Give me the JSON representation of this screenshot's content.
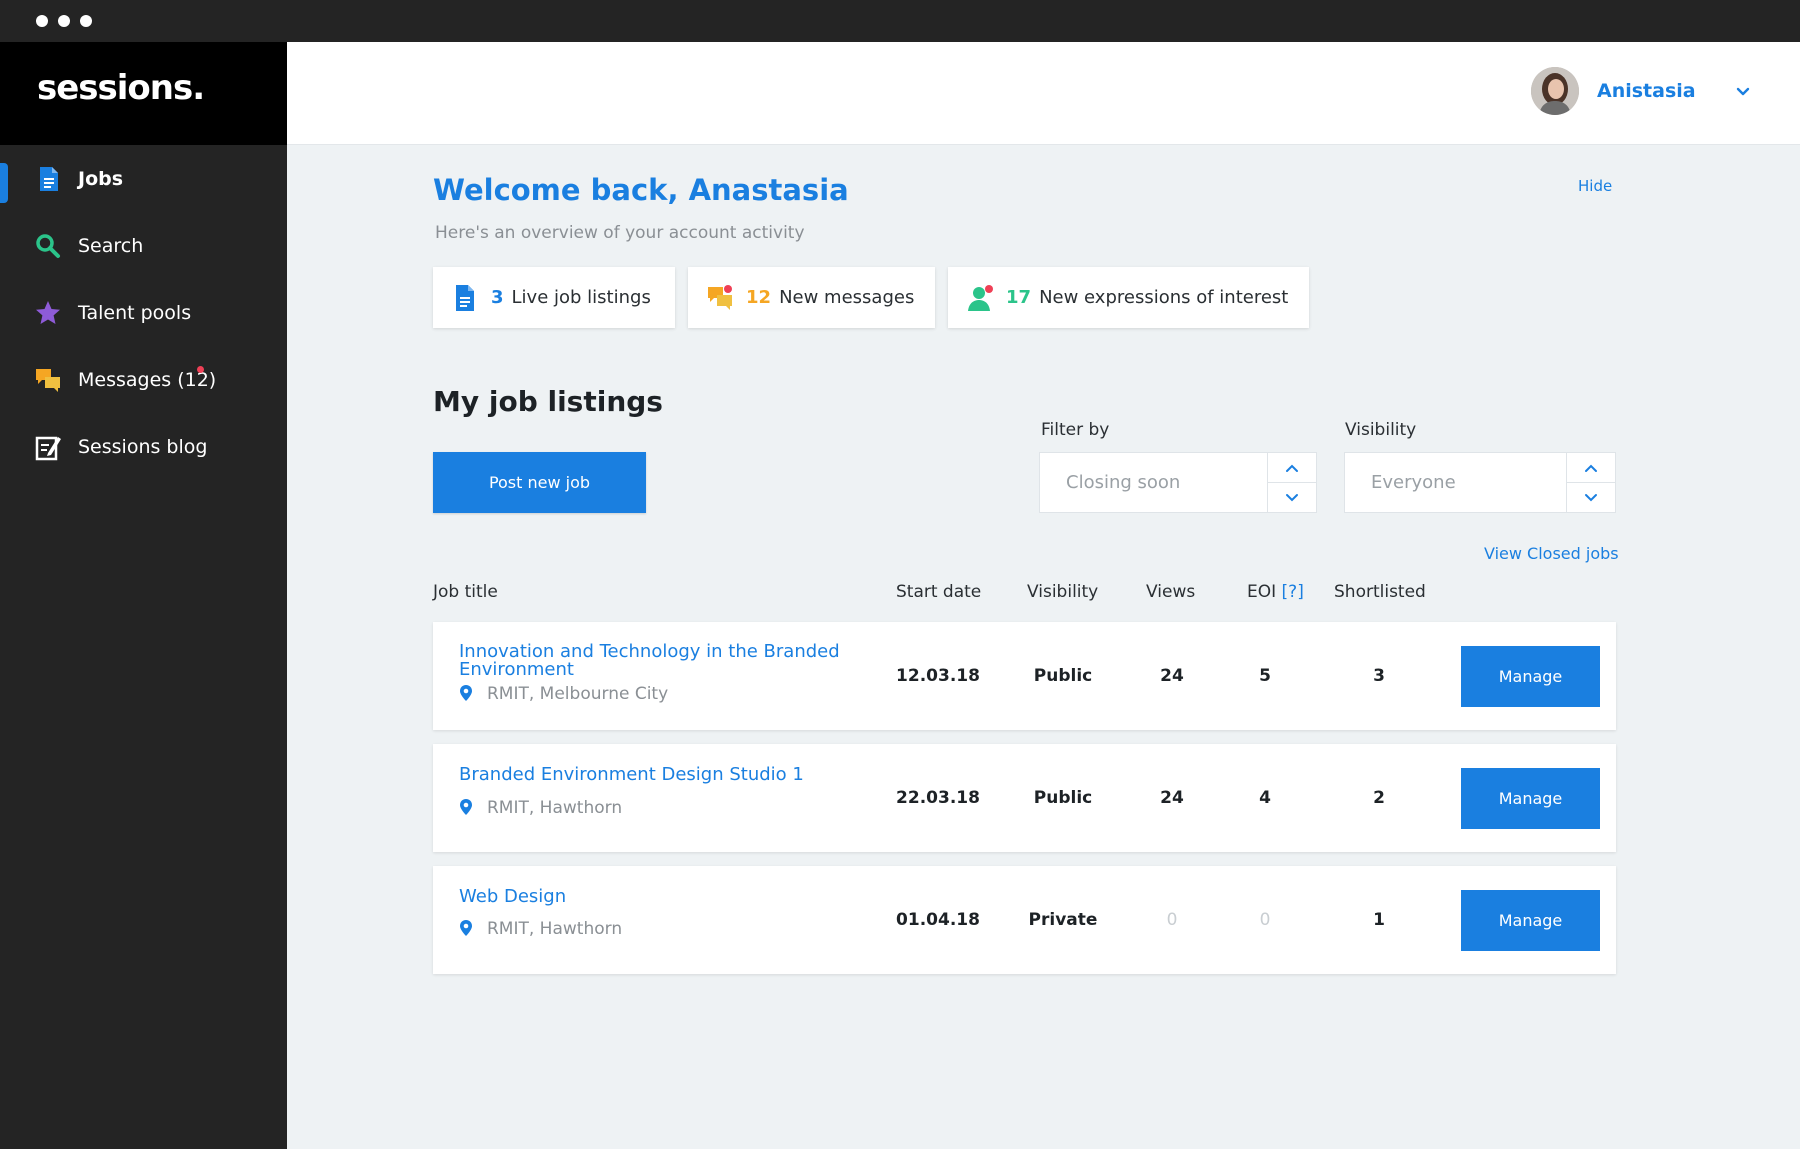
{
  "app": {
    "brand": "sessions.",
    "accent_color": "#1a7fe0"
  },
  "sidebar": {
    "items": [
      {
        "label": "Jobs",
        "icon": "document-icon",
        "active": true
      },
      {
        "label": "Search",
        "icon": "search-icon"
      },
      {
        "label": "Talent pools",
        "icon": "star-icon"
      },
      {
        "label": "Messages (12)",
        "icon": "chat-icon",
        "unread_dot": true
      },
      {
        "label": "Sessions blog",
        "icon": "blog-edit-icon"
      }
    ]
  },
  "header": {
    "user_name": "Anistasia"
  },
  "overview": {
    "welcome": "Welcome back, Anastasia",
    "subtitle": "Here's an overview of your account activity",
    "hide_label": "Hide",
    "stats": [
      {
        "count": "3",
        "label": "Live job listings",
        "color": "#1a7fe0"
      },
      {
        "count": "12",
        "label": "New messages",
        "color": "#f5a623"
      },
      {
        "count": "17",
        "label": "New expressions of interest",
        "color": "#2bc48a"
      }
    ]
  },
  "listings": {
    "title": "My job listings",
    "post_button": "Post new job",
    "filter_label": "Filter by",
    "filter_value": "Closing soon",
    "visibility_label": "Visibility",
    "visibility_value": "Everyone",
    "view_closed": "View Closed jobs",
    "columns": {
      "title": "Job title",
      "start": "Start date",
      "visibility": "Visibility",
      "views": "Views",
      "eoi": "EOI",
      "eoi_help": "[?]",
      "shortlisted": "Shortlisted"
    },
    "rows": [
      {
        "title": "Innovation and Technology in the Branded Environment",
        "location": "RMIT, Melbourne City",
        "start": "12.03.18",
        "visibility": "Public",
        "views": "24",
        "eoi": "5",
        "shortlisted": "3",
        "action": "Manage"
      },
      {
        "title": "Branded Environment Design Studio 1",
        "location": "RMIT, Hawthorn",
        "start": "22.03.18",
        "visibility": "Public",
        "views": "24",
        "eoi": "4",
        "shortlisted": "2",
        "action": "Manage"
      },
      {
        "title": "Web Design",
        "location": "RMIT, Hawthorn",
        "start": "01.04.18",
        "visibility": "Private",
        "views": "0",
        "eoi": "0",
        "shortlisted": "1",
        "action": "Manage"
      }
    ]
  }
}
